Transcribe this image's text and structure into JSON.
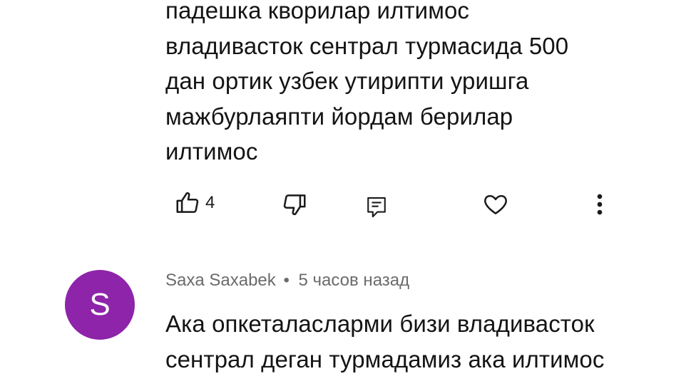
{
  "comment1": {
    "text": "падешка кворилар илтимос\nвладивасток сентрал турмасида 500\nдан ортик узбек утирипти уришга\nмажбурлаяпти йордам берилар\nилтимос",
    "like_count": "4",
    "actions": {
      "like_icon": "thumb-up-outline",
      "dislike_icon": "thumb-down-outline",
      "reply_icon": "comment-outline",
      "heart_icon": "heart-outline",
      "more_icon": "more-vertical"
    }
  },
  "comment2": {
    "avatar_letter": "S",
    "avatar_color": "#8e24aa",
    "author": "Saxa Saxabek",
    "separator": "•",
    "time": "5 часов назад",
    "text": "Ака опкеталасларми бизи владивасток\nсентрал деган турмадамиз ака илтимос"
  }
}
